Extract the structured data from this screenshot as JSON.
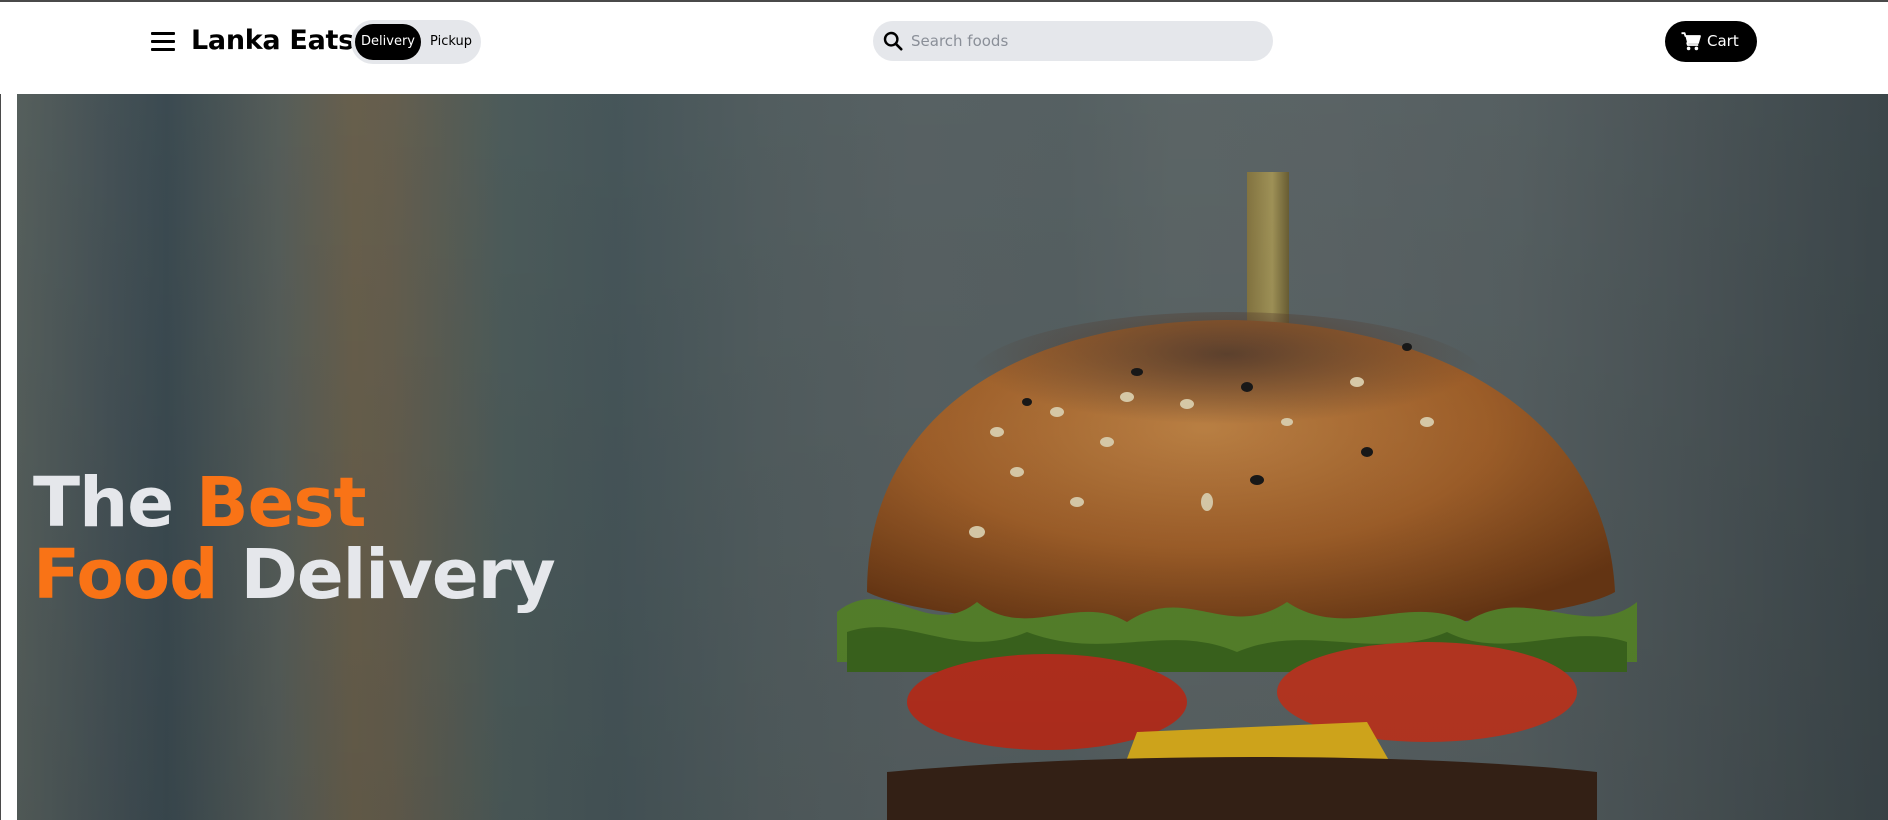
{
  "header": {
    "brand": "Lanka Eats",
    "mode_toggle": {
      "options": [
        "Delivery",
        "Pickup"
      ],
      "selected": "Delivery"
    },
    "search": {
      "placeholder": "Search foods",
      "value": ""
    },
    "cart_label": "Cart",
    "icons": {
      "menu": "hamburger-menu-icon",
      "search": "search-icon",
      "cart": "cart-icon"
    }
  },
  "hero": {
    "title_word1": "The",
    "title_word2": "Best",
    "title_word3": "Food",
    "title_word4": "Delivery",
    "image": "burger-photo"
  },
  "colors": {
    "accent": "#f97316",
    "toggle_bg": "#e5e7eb",
    "active_pill": "#000000",
    "hero_text": "#e5e7eb"
  }
}
